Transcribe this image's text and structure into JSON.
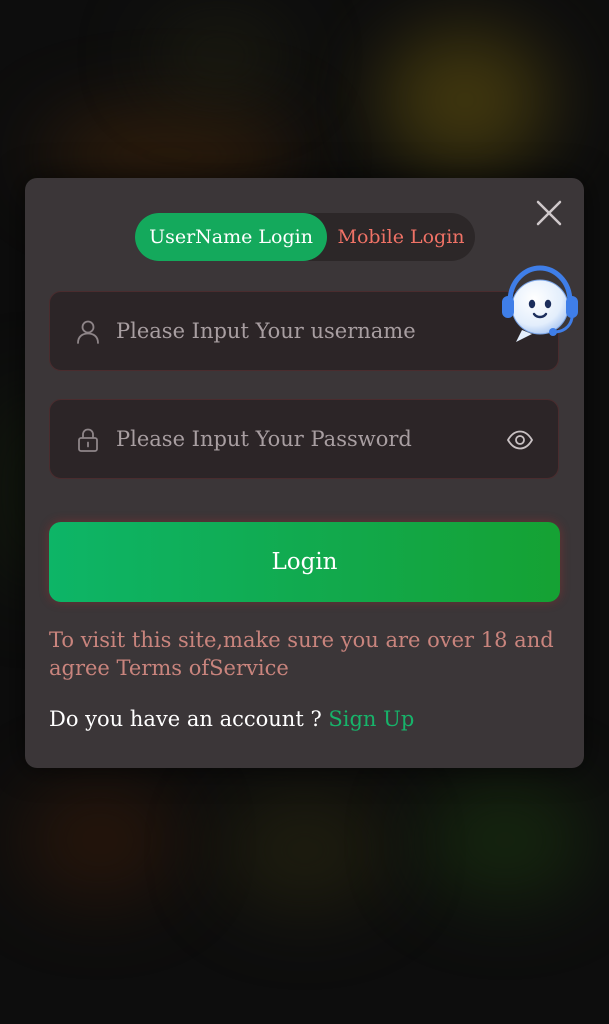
{
  "tabs": {
    "username_label": "UserName Login",
    "mobile_label": "Mobile Login",
    "active": "username"
  },
  "username": {
    "placeholder": "Please Input Your username",
    "value": ""
  },
  "password": {
    "placeholder": "Please Input Your Password",
    "value": ""
  },
  "login_label": "Login",
  "notice": "To visit this site,make sure you are over 18 and agree Terms ofService",
  "account_prompt": "Do you have an account ? ",
  "signup_label": "Sign Up",
  "icons": {
    "close": "close-icon",
    "user": "user-icon",
    "lock": "lock-icon",
    "eye": "eye-icon",
    "support": "customer-support-icon"
  },
  "colors": {
    "accent_green": "#14a95c",
    "mobile_tab_text": "#f07266",
    "notice_text": "#c9847d",
    "signup_link": "#17b36a",
    "modal_bg": "#3b3638"
  }
}
